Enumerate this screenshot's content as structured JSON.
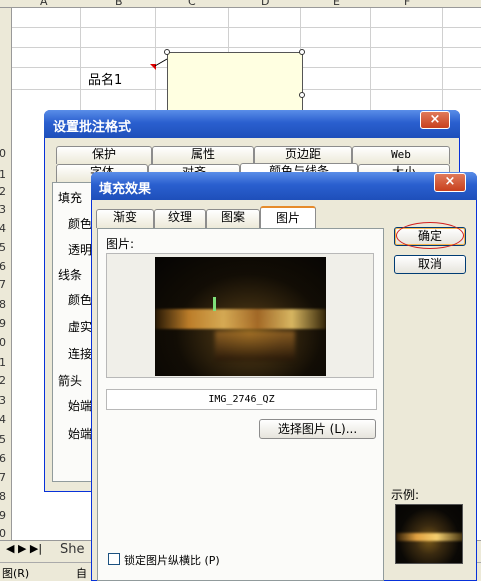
{
  "sheet": {
    "columns": [
      "A",
      "B",
      "C",
      "D",
      "E",
      "F"
    ],
    "rows": [
      "0",
      "1",
      "2",
      "3",
      "4",
      "5",
      "6",
      "7",
      "8",
      "9",
      "0",
      "1",
      "2",
      "3",
      "4",
      "5",
      "6",
      "7",
      "8",
      "9",
      "0"
    ],
    "cell_label": "品名1",
    "sheet_tab": "She",
    "status_left": "图(R)",
    "status_mid": "自"
  },
  "comment_dialog": {
    "title": "设置批注格式",
    "close": "×",
    "tabs_row1": [
      "保护",
      "属性",
      "页边距",
      "Web"
    ],
    "tabs_row2": [
      "字体",
      "对齐",
      "颜色与线条",
      "大小"
    ],
    "sections": [
      "填充",
      "颜色",
      "透明",
      "线条",
      "颜色",
      "虚实",
      "连接",
      "箭头",
      "始端",
      "始端"
    ]
  },
  "fill_dialog": {
    "title": "填充效果",
    "close": "×",
    "tabs": [
      "渐变",
      "纹理",
      "图案",
      "图片"
    ],
    "picture_label": "图片:",
    "file_name": "IMG_2746_QZ",
    "select_button": "选择图片 (L)...",
    "lock_label": "锁定图片纵横比 (P)",
    "ok": "确定",
    "cancel": "取消",
    "sample_label": "示例:"
  }
}
